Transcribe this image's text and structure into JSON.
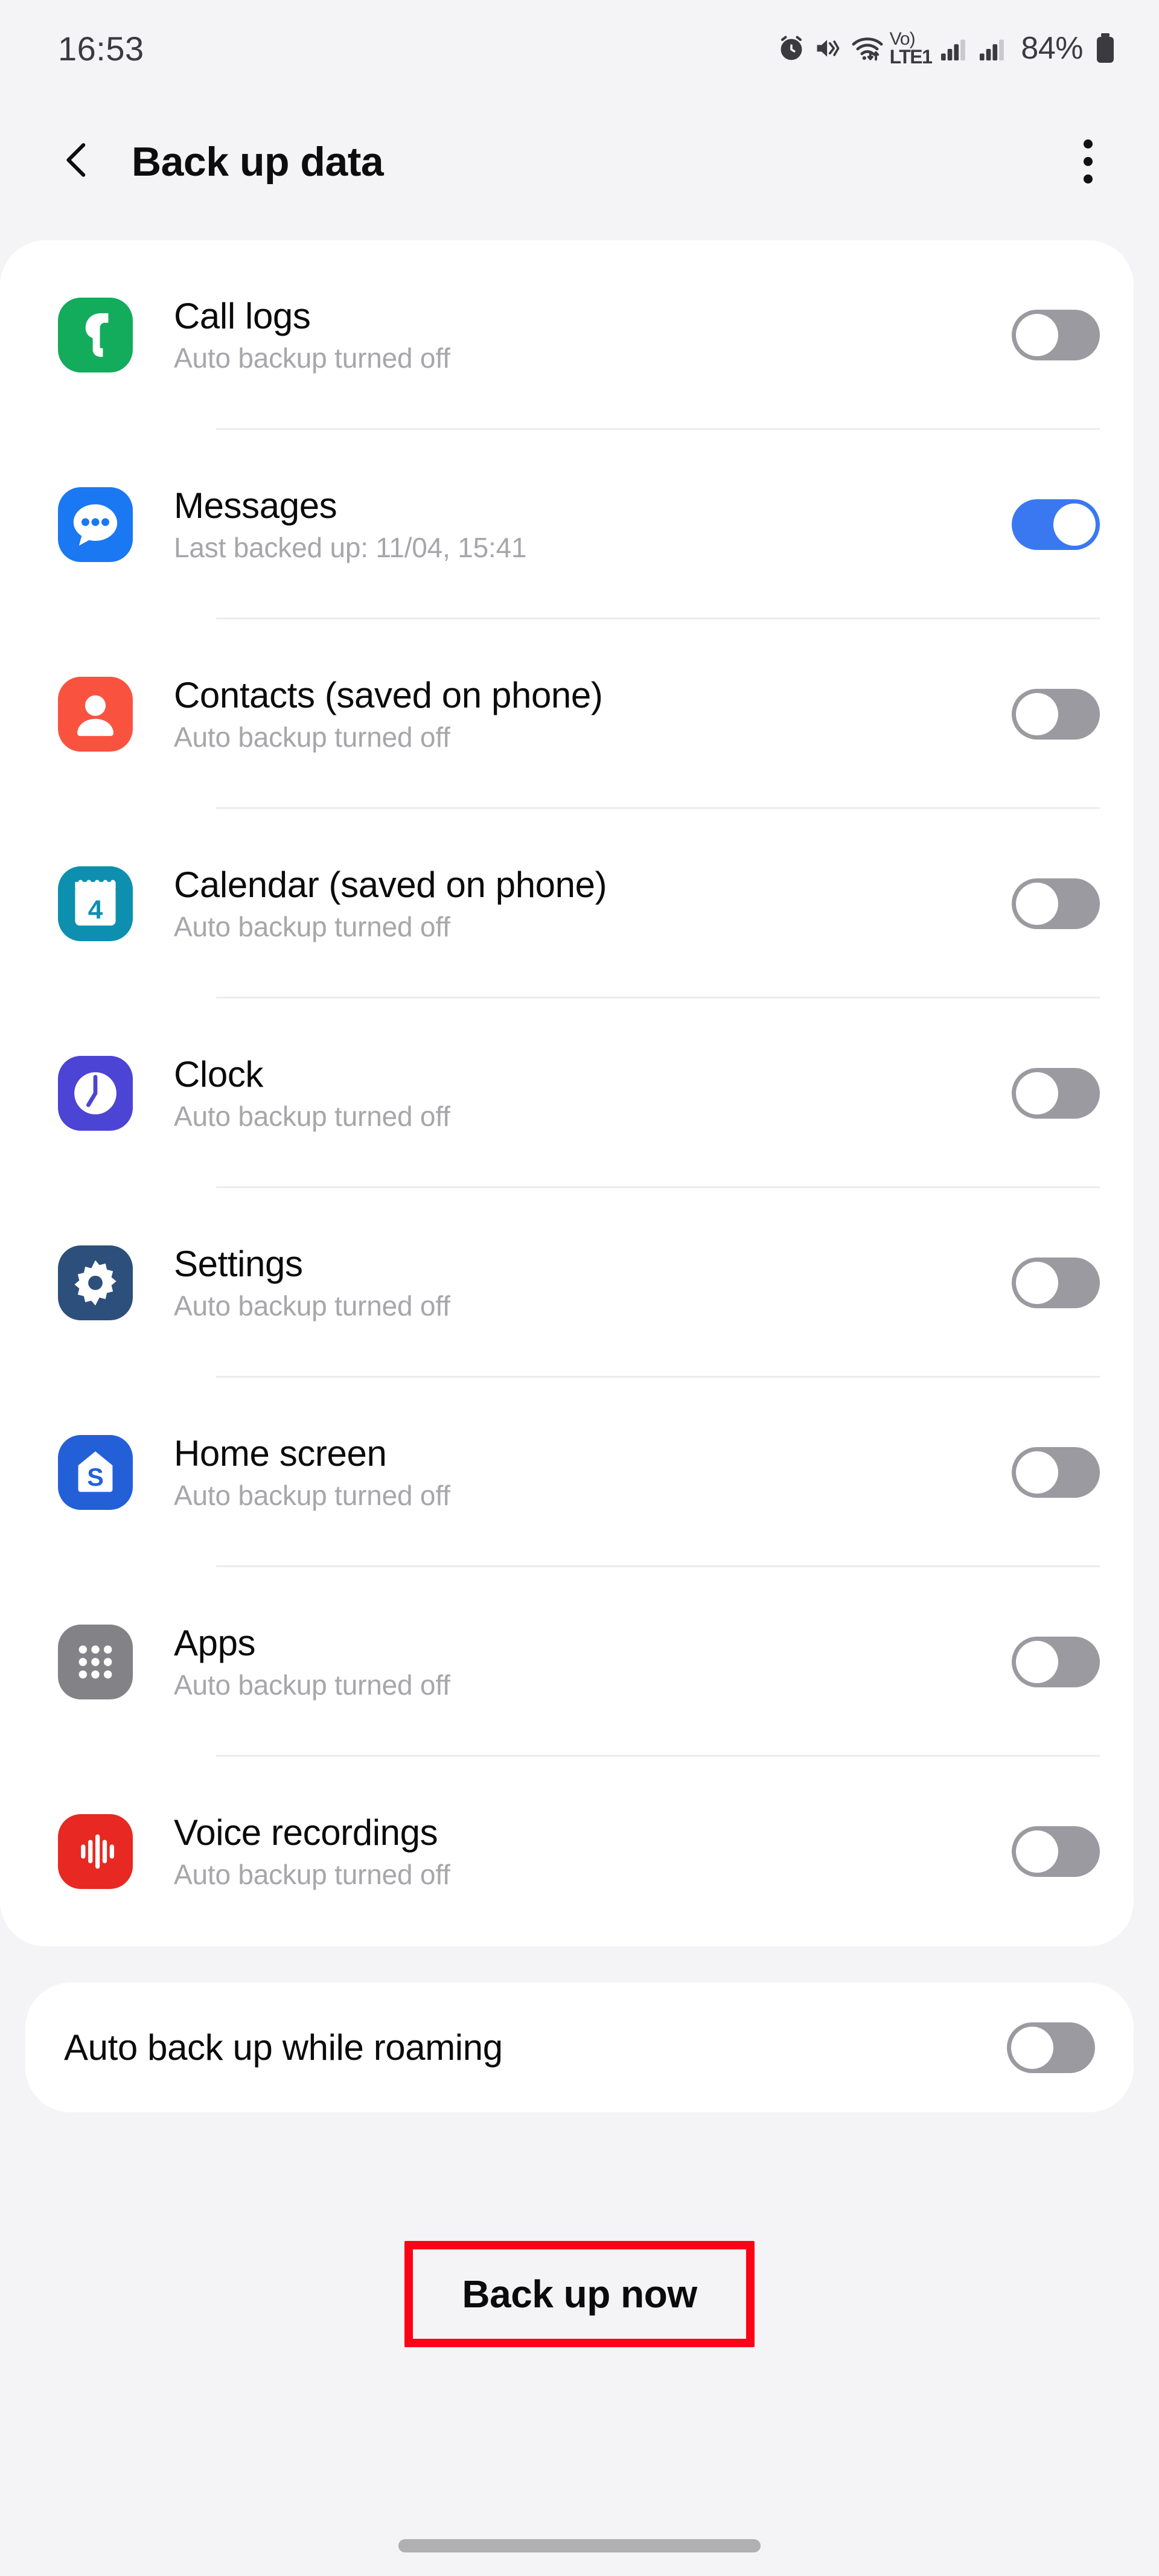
{
  "statusbar": {
    "time": "16:53",
    "battery_percent": "84%",
    "network_label": "LTE1",
    "volte_label": "Vo)",
    "icons": [
      "alarm-icon",
      "mute-vibrate-icon",
      "wifi-icon",
      "volte-icon",
      "signal-bars-sim1-icon",
      "signal-bars-sim2-icon",
      "battery-icon"
    ]
  },
  "appbar": {
    "back_icon": "chevron-left-icon",
    "title": "Back up data",
    "menu_icon": "more-vertical-icon"
  },
  "backup_items": [
    {
      "title": "Call logs",
      "subtitle": "Auto backup turned off",
      "icon": "phone-icon",
      "icon_bg": "#13ab5c",
      "enabled": false
    },
    {
      "title": "Messages",
      "subtitle": "Last backed up: 11/04, 15:41",
      "icon": "message-bubble-icon",
      "icon_bg": "#1a78f2",
      "enabled": true
    },
    {
      "title": "Contacts (saved on phone)",
      "subtitle": "Auto backup turned off",
      "icon": "contacts-person-icon",
      "icon_bg": "#f9533f",
      "enabled": false
    },
    {
      "title": "Calendar (saved on phone)",
      "subtitle": "Auto backup turned off",
      "icon": "calendar-icon",
      "icon_bg": "#0d8fb0",
      "enabled": false,
      "icon_day": "4"
    },
    {
      "title": "Clock",
      "subtitle": "Auto backup turned off",
      "icon": "clock-icon",
      "icon_bg": "#4c44d4",
      "enabled": false
    },
    {
      "title": "Settings",
      "subtitle": "Auto backup turned off",
      "icon": "gear-icon",
      "icon_bg": "#2d4f7c",
      "enabled": false
    },
    {
      "title": "Home screen",
      "subtitle": "Auto backup turned off",
      "icon": "home-screen-icon",
      "icon_bg": "#2360d8",
      "enabled": false,
      "icon_letter": "S"
    },
    {
      "title": "Apps",
      "subtitle": "Auto backup turned off",
      "icon": "apps-grid-icon",
      "icon_bg": "#828287",
      "enabled": false
    },
    {
      "title": "Voice recordings",
      "subtitle": "Auto backup turned off",
      "icon": "voice-waveform-icon",
      "icon_bg": "#e82822",
      "enabled": false
    }
  ],
  "roaming": {
    "label": "Auto back up while roaming",
    "enabled": false
  },
  "backup_now": {
    "label": "Back up now",
    "highlight_color": "#fb0417"
  },
  "colors": {
    "page_bg": "#f4f4f6",
    "card_bg": "#ffffff",
    "toggle_on": "#3a78f2",
    "toggle_off": "#9a9aa0",
    "title_text": "#0b0b0b",
    "subtitle_text": "#a6a6ab"
  }
}
